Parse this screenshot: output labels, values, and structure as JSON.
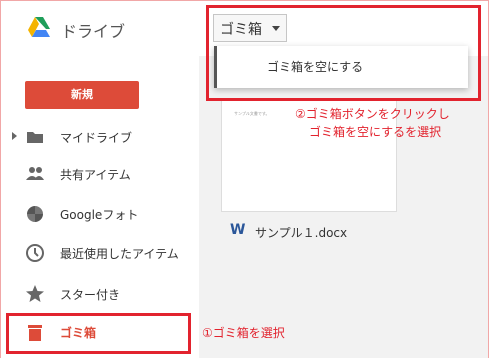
{
  "app": {
    "name": "ドライブ"
  },
  "toolbar": {
    "trash_dropdown_label": "ゴミ箱"
  },
  "menu": {
    "empty_trash_label": "ゴミ箱を空にする"
  },
  "sidebar": {
    "new_button_label": "新規",
    "items": [
      {
        "label": "マイドライブ",
        "icon": "drive-icon"
      },
      {
        "label": "共有アイテム",
        "icon": "people-icon"
      },
      {
        "label": "Googleフォト",
        "icon": "photos-icon"
      },
      {
        "label": "最近使用したアイテム",
        "icon": "clock-icon"
      },
      {
        "label": "スター付き",
        "icon": "star-icon"
      },
      {
        "label": "ゴミ箱",
        "icon": "trash-icon",
        "selected": true,
        "accent": "#dd4b39"
      }
    ]
  },
  "main": {
    "file": {
      "name": "サンプル１.docx",
      "icon": "word-icon",
      "preview_text": "サンプル文書です。"
    }
  },
  "annotations": {
    "step1": "①ゴミ箱を選択",
    "step2_line1": "②ゴミ箱ボタンをクリックし",
    "step2_line2": "ゴミ箱を空にするを選択"
  },
  "colors": {
    "accent_red": "#e2232e",
    "new_button": "#dd4b39"
  }
}
